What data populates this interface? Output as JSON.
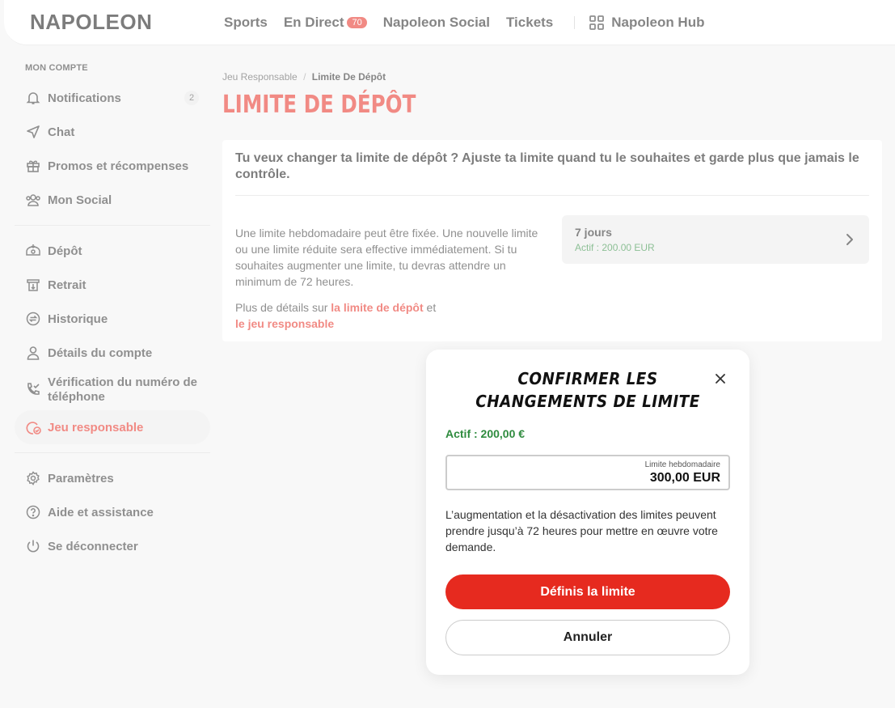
{
  "header": {
    "logo": "NAPOLEON",
    "nav": [
      {
        "label": "Sports"
      },
      {
        "label": "En Direct",
        "badge": "70"
      },
      {
        "label": "Napoleon Social"
      },
      {
        "label": "Tickets"
      }
    ],
    "hub": {
      "label": "Napoleon Hub",
      "icon": "grid-icon"
    }
  },
  "sidebar": {
    "section_title": "MON COMPTE",
    "group1": [
      {
        "label": "Notifications",
        "icon": "bell-icon",
        "count": "2"
      },
      {
        "label": "Chat",
        "icon": "send-icon"
      },
      {
        "label": "Promos et récompenses",
        "icon": "gift-icon"
      },
      {
        "label": "Mon Social",
        "icon": "users-icon"
      }
    ],
    "group2": [
      {
        "label": "Dépôt",
        "icon": "deposit-icon"
      },
      {
        "label": "Retrait",
        "icon": "withdraw-icon"
      },
      {
        "label": "Historique",
        "icon": "history-icon"
      },
      {
        "label": "Détails du compte",
        "icon": "user-icon"
      },
      {
        "label": "Vérification du numéro de téléphone",
        "icon": "phone-check-icon"
      },
      {
        "label": "Jeu responsable",
        "icon": "responsible-gaming-icon",
        "active": true
      }
    ],
    "group3": [
      {
        "label": "Paramètres",
        "icon": "gear-icon"
      },
      {
        "label": "Aide et assistance",
        "icon": "help-icon"
      },
      {
        "label": "Se déconnecter",
        "icon": "power-icon"
      }
    ]
  },
  "breadcrumb": {
    "parent": "Jeu Responsable",
    "separator": "/",
    "current": "Limite De Dépôt"
  },
  "page_title": "LIMITE DE DÉPÔT",
  "card": {
    "heading": "Tu veux changer ta limite de dépôt ? Ajuste ta limite quand tu le souhaites et garde plus que jamais le contrôle.",
    "description": "Une limite hebdomadaire peut être fixée. Une nouvelle limite ou une limite réduite sera effective immédiatement. Si tu souhaites augmenter une limite, tu devras attendre un minimum de 72 heures.",
    "more_prefix": "Plus de détails sur ",
    "more_link1": "la limite de dépôt",
    "more_mid": " et",
    "more_link2": "le jeu responsable",
    "period": {
      "label": "7 jours",
      "status": "Actif : 200.00 EUR"
    }
  },
  "modal": {
    "title_line1": "CONFIRMER LES",
    "title_line2": "CHANGEMENTS DE LIMITE",
    "active": "Actif : 200,00 €",
    "input_caption": "Limite hebdomadaire",
    "input_value": "300,00 EUR",
    "note": "L’augmentation et la désactivation des limites peuvent prendre jusqu’à 72 heures pour mettre en œuvre votre demande.",
    "confirm_label": "Définis la limite",
    "cancel_label": "Annuler"
  },
  "colors": {
    "accent": "#e62a1f",
    "success": "#2e8b3e",
    "background": "#f3f3f3"
  }
}
